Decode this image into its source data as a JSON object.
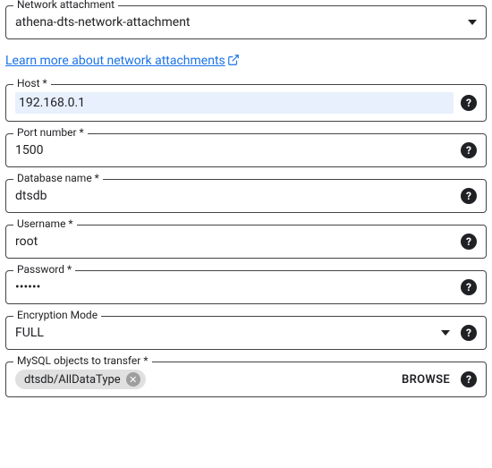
{
  "network_attachment": {
    "label": "Network attachment",
    "value": "athena-dts-network-attachment"
  },
  "learn_more": {
    "text": "Learn more about network attachments"
  },
  "host": {
    "label": "Host *",
    "value": "192.168.0.1"
  },
  "port": {
    "label": "Port number *",
    "value": "1500"
  },
  "database": {
    "label": "Database name *",
    "value": "dtsdb"
  },
  "username": {
    "label": "Username *",
    "value": "root"
  },
  "password": {
    "label": "Password *",
    "value": "••••••"
  },
  "encryption": {
    "label": "Encryption Mode",
    "value": "FULL"
  },
  "objects": {
    "label": "MySQL objects to transfer *",
    "chip": "dtsdb/AllDataType",
    "browse": "BROWSE"
  }
}
